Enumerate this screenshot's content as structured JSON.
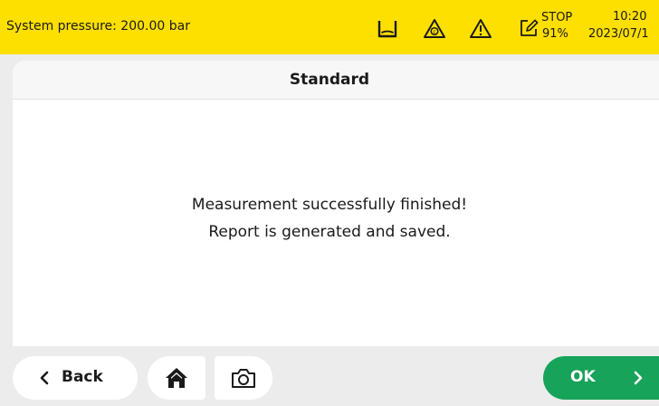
{
  "status_bar": {
    "pressure_text": "System pressure: 200.00 bar",
    "stop_label": "STOP",
    "stop_percent": "91%",
    "time": "10:20",
    "date": "2023/07/1",
    "icons": [
      "tray-icon",
      "c-warning-icon",
      "warning-icon",
      "edit-icon"
    ],
    "background_color": "#fddf00"
  },
  "card": {
    "title": "Standard",
    "message_line1": "Measurement successfully finished!",
    "message_line2": "Report is generated and saved."
  },
  "bottom_bar": {
    "back_label": "Back",
    "ok_label": "OK",
    "ok_color": "#18a35a",
    "icons": [
      "chevron-left-icon",
      "home-icon",
      "camera-icon",
      "chevron-right-icon"
    ]
  }
}
